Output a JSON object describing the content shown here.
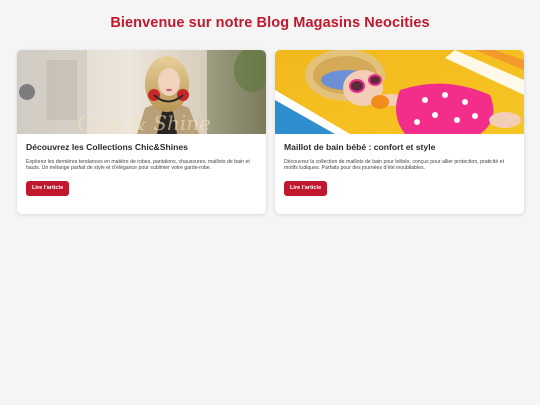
{
  "colors": {
    "accent": "#c0182c",
    "background": "#f5f5f5",
    "card": "#ffffff",
    "title_text": "#2b2b2b"
  },
  "page_title": "Bienvenue sur notre Blog Magasins Neocities",
  "articles": [
    {
      "title": "Découvrez les Collections Chic&Shines",
      "description": "Explorez les dernières tendances en matière de robes, pantalons, chaussures, maillots de bain et hauts. Un mélange parfait de style et d’élégance pour sublimer votre garde-robe.",
      "button_label": "Lire l'article",
      "image_icon": "fashion-photo"
    },
    {
      "title": "Maillot de bain bébé : confort et style",
      "description": "Découvrez la collection de maillots de bain pour bébés, conçus pour allier protection, praticité et motifs ludiques. Parfaits pour des journées d’été inoubliables.",
      "button_label": "Lire l'article",
      "image_icon": "baby-swimwear-photo"
    }
  ]
}
